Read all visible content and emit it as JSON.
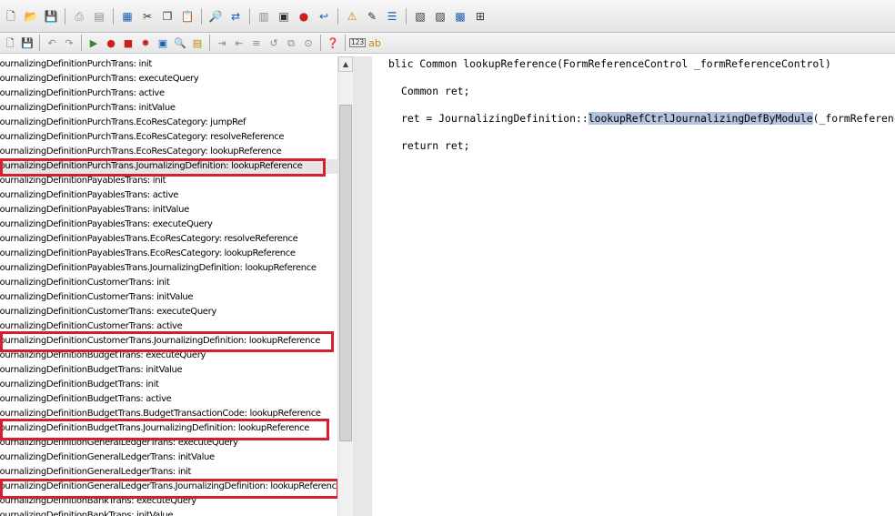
{
  "toolbar1": {
    "icons": [
      "new-icon",
      "open-icon",
      "save-icon",
      "print-icon",
      "print-preview-icon",
      "properties-icon",
      "cut-icon",
      "copy-icon",
      "paste-icon",
      "find-icon",
      "replace-icon",
      "view-icon",
      "compile-icon",
      "stop-icon",
      "back-icon",
      "alert-icon",
      "edit-icon",
      "list-icon",
      "form-icon",
      "report-icon",
      "query-icon",
      "table-icon"
    ]
  },
  "toolbar2": {
    "icons": [
      "new-icon",
      "save-icon",
      "undo-icon",
      "redo-icon",
      "run-icon",
      "breakpoint-icon",
      "remove-breakpoint-icon",
      "debug-icon",
      "compile-icon",
      "lookup-icon",
      "script-icon",
      "indent-icon",
      "outdent-icon",
      "comment-icon",
      "uncomment-icon",
      "links-icon",
      "help-icon"
    ],
    "badge_123": "123",
    "badge_ab": "ab"
  },
  "tree": {
    "items": [
      "JournalizingDefinitionPurchTrans: init",
      "JournalizingDefinitionPurchTrans: executeQuery",
      "JournalizingDefinitionPurchTrans: active",
      "JournalizingDefinitionPurchTrans: initValue",
      "JournalizingDefinitionPurchTrans.EcoResCategory: jumpRef",
      "JournalizingDefinitionPurchTrans.EcoResCategory: resolveReference",
      "JournalizingDefinitionPurchTrans.EcoResCategory: lookupReference",
      "JournalizingDefinitionPurchTrans.JournalizingDefinition: lookupReference",
      "JournalizingDefinitionPayablesTrans: init",
      "JournalizingDefinitionPayablesTrans: active",
      "JournalizingDefinitionPayablesTrans: initValue",
      "JournalizingDefinitionPayablesTrans: executeQuery",
      "JournalizingDefinitionPayablesTrans.EcoResCategory: resolveReference",
      "JournalizingDefinitionPayablesTrans.EcoResCategory: lookupReference",
      "JournalizingDefinitionPayablesTrans.JournalizingDefinition: lookupReference",
      "JournalizingDefinitionCustomerTrans: init",
      "JournalizingDefinitionCustomerTrans: initValue",
      "JournalizingDefinitionCustomerTrans: executeQuery",
      "JournalizingDefinitionCustomerTrans: active",
      "JournalizingDefinitionCustomerTrans.JournalizingDefinition: lookupReference",
      "JournalizingDefinitionBudgetTrans: executeQuery",
      "JournalizingDefinitionBudgetTrans: initValue",
      "JournalizingDefinitionBudgetTrans: init",
      "JournalizingDefinitionBudgetTrans: active",
      "JournalizingDefinitionBudgetTrans.BudgetTransactionCode: lookupReference",
      "JournalizingDefinitionBudgetTrans.JournalizingDefinition: lookupReference",
      "JournalizingDefinitionGeneralLedgerTrans: executeQuery",
      "JournalizingDefinitionGeneralLedgerTrans: initValue",
      "JournalizingDefinitionGeneralLedgerTrans: init",
      "JournalizingDefinitionGeneralLedgerTrans.JournalizingDefinition: lookupReference",
      "JournalizingDefinitionBankTrans: executeQuery",
      "JournalizingDefinitionBankTrans: initValue"
    ],
    "selected_index": 7
  },
  "colors": {
    "highlight_border": "#d51f2f",
    "code_selection": "#b5c4dd"
  },
  "editor": {
    "line1": "blic Common lookupReference(FormReferenceControl _formReferenceControl)",
    "line2": "Common ret;",
    "line3_prefix": "ret = JournalizingDefinition::",
    "line3_selected": "lookupRefCtrlJournalizingDefByModule",
    "line3_suffix": "(_formReferenceControl",
    "line4": "return ret;"
  }
}
